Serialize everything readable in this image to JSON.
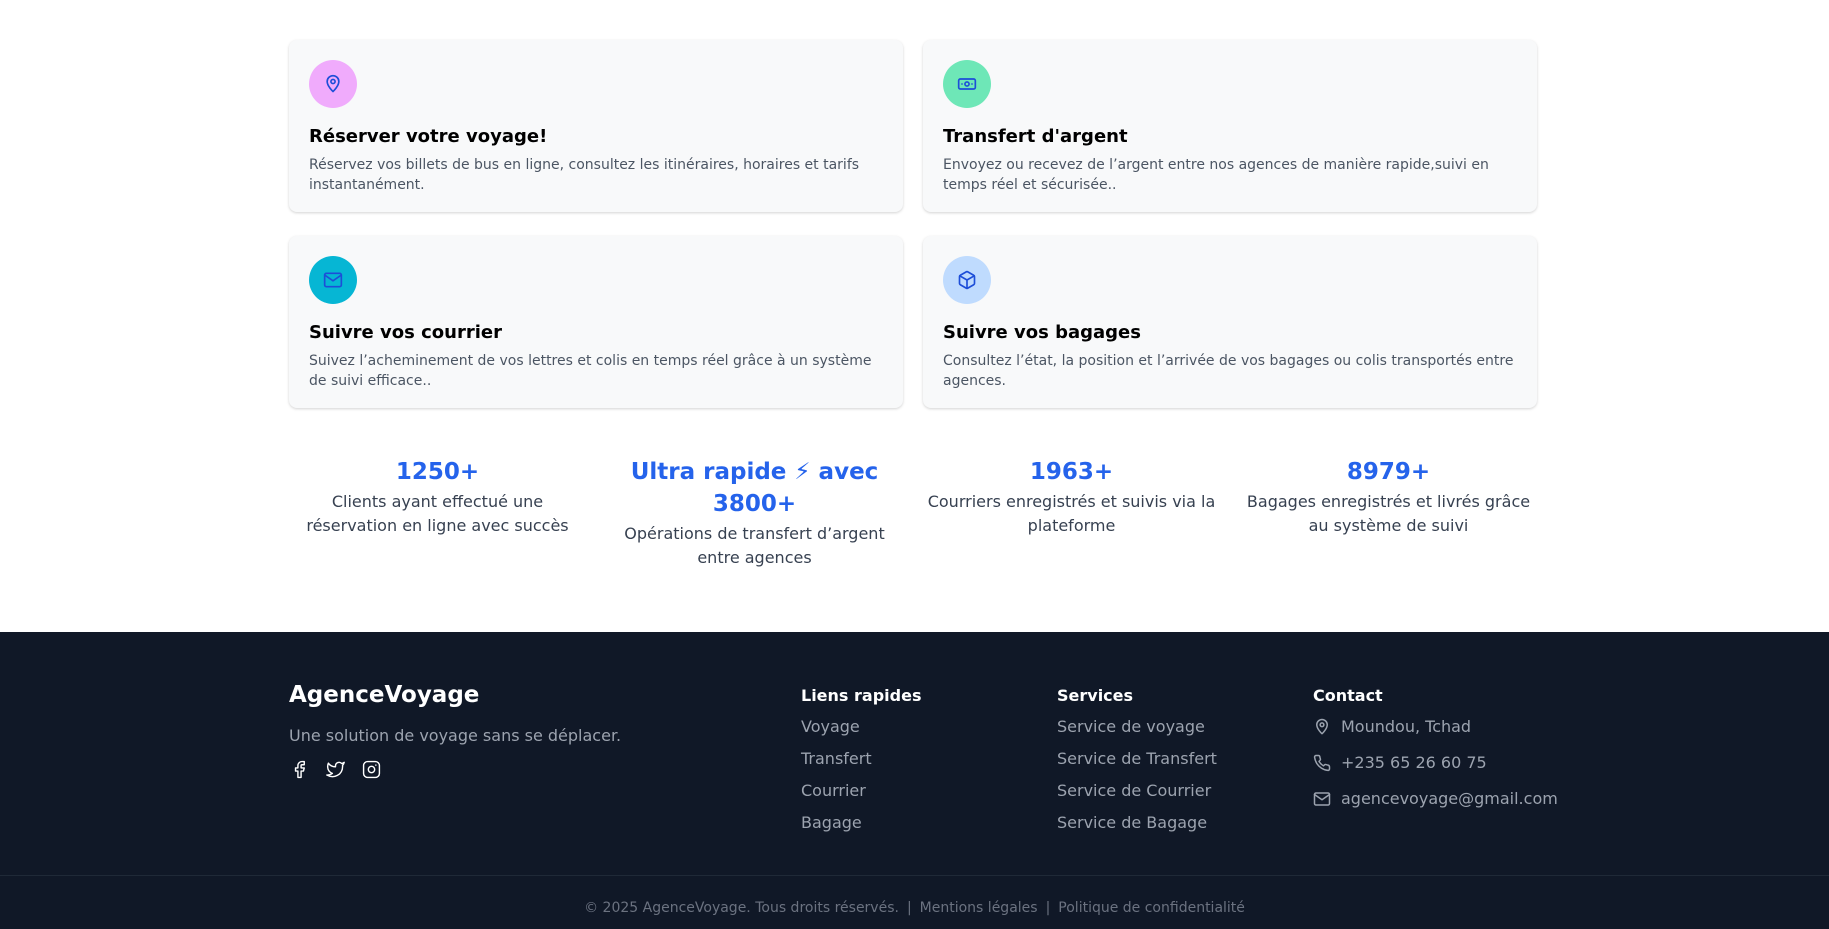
{
  "services": [
    {
      "title": "Réserver votre voyage!",
      "desc": "Réservez vos billets de bus en ligne, consultez les itinéraires, horaires et tarifs instantanément.",
      "icon": "map-pin-icon",
      "icon_bg": "#f0abfc",
      "icon_color": "#1d4ed8"
    },
    {
      "title": "Transfert d'argent",
      "desc": "Envoyez ou recevez de l’argent entre nos agences de manière rapide,suivi en temps réel et sécurisée..",
      "icon": "banknote-icon",
      "icon_bg": "#6ee7b7",
      "icon_color": "#1d4ed8"
    },
    {
      "title": "Suivre vos courrier",
      "desc": "Suivez l’acheminement de vos lettres et colis en temps réel grâce à un système de suivi efficace..",
      "icon": "mail-icon",
      "icon_bg": "#06b6d4",
      "icon_color": "#1d4ed8"
    },
    {
      "title": "Suivre vos bagages",
      "desc": "Consultez l’état, la position et l’arrivée de vos bagages ou colis transportés entre agences.",
      "icon": "package-icon",
      "icon_bg": "#bfdbfe",
      "icon_color": "#1d4ed8"
    }
  ],
  "stats": [
    {
      "value": "1250+",
      "label": "Clients ayant effectué une réservation en ligne avec succès"
    },
    {
      "value": "Ultra rapide ⚡ avec 3800+",
      "label": "Opérations de transfert d’argent entre agences"
    },
    {
      "value": "1963+",
      "label": "Courriers enregistrés et suivis via la plateforme"
    },
    {
      "value": "8979+",
      "label": "Bagages enregistrés et livrés grâce au système de suivi"
    }
  ],
  "footer": {
    "brand": "AgenceVoyage",
    "tagline": "Une solution de voyage sans se déplacer.",
    "socials": [
      "facebook-icon",
      "twitter-icon",
      "instagram-icon"
    ],
    "quick_links": {
      "title": "Liens rapides",
      "items": [
        "Voyage",
        "Transfert",
        "Courrier",
        "Bagage"
      ]
    },
    "services": {
      "title": "Services",
      "items": [
        "Service de voyage",
        "Service de Transfert",
        "Service de Courrier",
        "Service de Bagage"
      ]
    },
    "contact": {
      "title": "Contact",
      "location": "Moundou, Tchad",
      "phone": "+235 65 26 60 75",
      "email": "agencevoyage@gmail.com"
    },
    "copyright": "© 2025 AgenceVoyage. Tous droits réservés.",
    "legal": "Mentions légales",
    "privacy": "Politique de confidentialité",
    "separator": "|"
  },
  "colors": {
    "accent": "#2563eb",
    "footer_bg": "#101827"
  }
}
